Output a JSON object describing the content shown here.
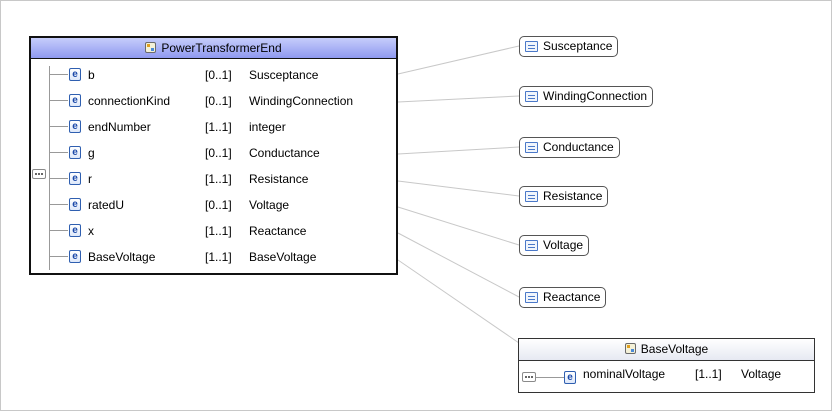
{
  "main_class": {
    "title": "PowerTransformerEnd",
    "icon": "class-icon",
    "attributes": [
      {
        "name": "b",
        "multiplicity": "[0..1]",
        "type": "Susceptance"
      },
      {
        "name": "connectionKind",
        "multiplicity": "[0..1]",
        "type": "WindingConnection"
      },
      {
        "name": "endNumber",
        "multiplicity": "[1..1]",
        "type": "integer"
      },
      {
        "name": "g",
        "multiplicity": "[0..1]",
        "type": "Conductance"
      },
      {
        "name": "r",
        "multiplicity": "[1..1]",
        "type": "Resistance"
      },
      {
        "name": "ratedU",
        "multiplicity": "[0..1]",
        "type": "Voltage"
      },
      {
        "name": "x",
        "multiplicity": "[1..1]",
        "type": "Reactance"
      },
      {
        "name": "BaseVoltage",
        "multiplicity": "[1..1]",
        "type": "BaseVoltage"
      }
    ]
  },
  "type_boxes": [
    {
      "label": "Susceptance"
    },
    {
      "label": "WindingConnection"
    },
    {
      "label": "Conductance"
    },
    {
      "label": "Resistance"
    },
    {
      "label": "Voltage"
    },
    {
      "label": "Reactance"
    }
  ],
  "base_voltage_class": {
    "title": "BaseVoltage",
    "attribute": {
      "name": "nominalVoltage",
      "multiplicity": "[1..1]",
      "type": "Voltage"
    }
  },
  "colors": {
    "header_blue": "#8f99f0",
    "element_icon": "#2f5fb0",
    "connector": "#c8c8c8"
  }
}
